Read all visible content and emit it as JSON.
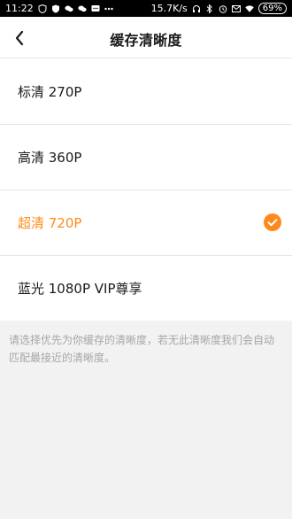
{
  "status_bar": {
    "time": "11:22",
    "network_speed": "15.7K/s",
    "battery": "69%",
    "icons_left": [
      "shield-icon",
      "security-icon",
      "wechat-icon",
      "wechat-icon",
      "sms-icon",
      "more-icon"
    ],
    "icons_right": [
      "headphones-icon",
      "bluetooth-icon",
      "alarm-icon",
      "mail-icon",
      "wifi-icon",
      "battery-icon"
    ]
  },
  "nav": {
    "title": "缓存清晰度",
    "back_icon": "chevron-left-icon"
  },
  "options": [
    {
      "label": "标清 270P",
      "selected": false
    },
    {
      "label": "高清 360P",
      "selected": false
    },
    {
      "label": "超清 720P",
      "selected": true
    },
    {
      "label": "蓝光 1080P  VIP尊享",
      "selected": false
    }
  ],
  "accent_color": "#ff8a1c",
  "hint": "请选择优先为你缓存的清晰度，若无此清晰度我们会自动匹配最接近的清晰度。"
}
